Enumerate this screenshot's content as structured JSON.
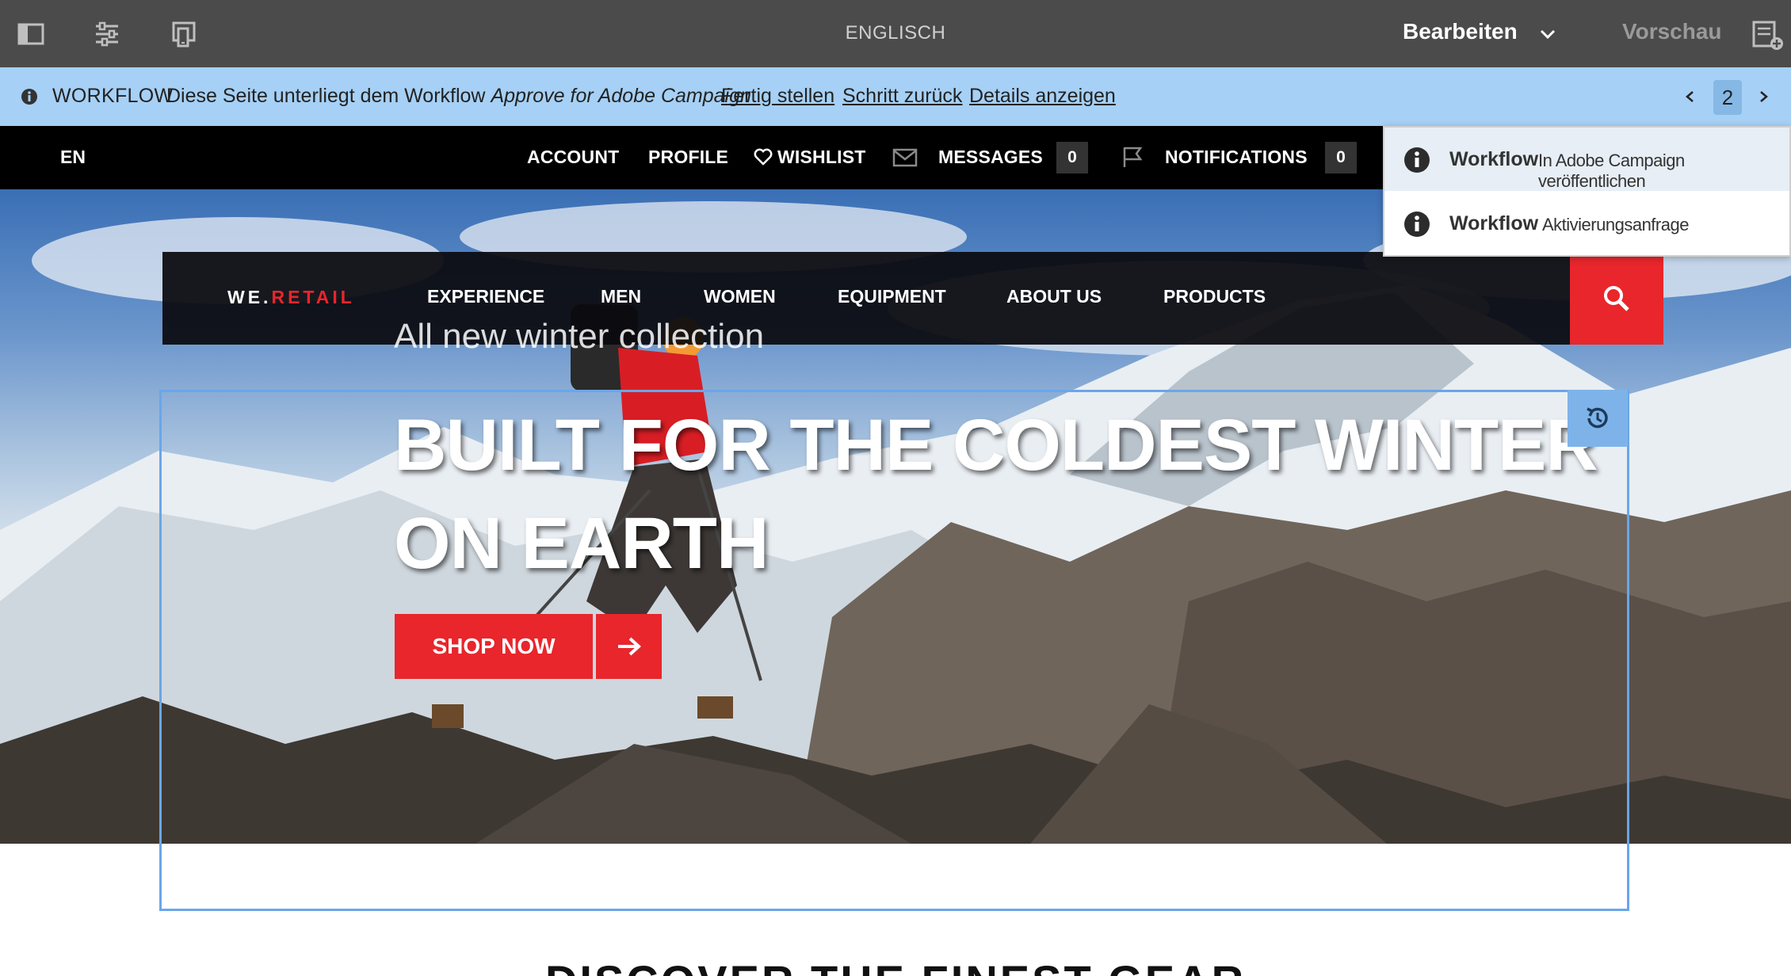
{
  "editor": {
    "language": "ENGLISCH",
    "mode_edit": "Bearbeiten",
    "mode_preview": "Vorschau",
    "icons": [
      "side-panel-icon",
      "page-properties-icon",
      "emulator-icon",
      "chevron-down-icon",
      "annotations-icon"
    ]
  },
  "status": {
    "label": "WORKFLOW",
    "text_prefix": "Diese Seite unterliegt dem Workflow",
    "workflow_name": "Approve for Adobe Campaign",
    "links": [
      "Fertig stellen",
      "Schritt zurück",
      "Details anzeigen"
    ],
    "page_number": "2"
  },
  "site": {
    "language": "EN",
    "top_nav": [
      "ACCOUNT",
      "PROFILE",
      "WISHLIST",
      "MESSAGES",
      "NOTIFICATIONS"
    ],
    "messages_count": "0",
    "notifications_count": "0",
    "logo_prefix": "WE.",
    "logo_suffix": "RETAIL",
    "main_nav": [
      "EXPERIENCE",
      "MEN",
      "WOMEN",
      "EQUIPMENT",
      "ABOUT US",
      "PRODUCTS"
    ],
    "brand_red": "#e8262c"
  },
  "hero": {
    "kicker": "All new winter collection",
    "title": "BUILT FOR THE COLDEST WINTER ON EARTH",
    "cta": "SHOP NOW"
  },
  "section": {
    "title": "DISCOVER THE FINEST GEAR"
  },
  "workflows": [
    {
      "title": "Workflow",
      "description": "In Adobe Campaign veröffentlichen"
    },
    {
      "title": "Workflow",
      "description": "Aktivierungsanfrage"
    }
  ]
}
